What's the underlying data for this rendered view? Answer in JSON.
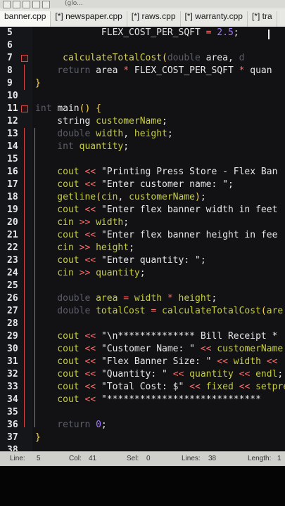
{
  "toolbar": {
    "hint": "(glo..."
  },
  "tabs": [
    {
      "label": "banner.cpp",
      "active": true
    },
    {
      "label": "[*] newspaper.cpp",
      "active": false
    },
    {
      "label": "[*] raws.cpp",
      "active": false
    },
    {
      "label": "[*] warranty.cpp",
      "active": false
    },
    {
      "label": "[*] tra",
      "active": false
    }
  ],
  "editor": {
    "lines": [
      {
        "n": "5",
        "parts": [
          [
            "t",
            "            FLEX_COST_PER_SQFT "
          ],
          [
            "op",
            "="
          ],
          [
            "num",
            " 2.5"
          ],
          [
            "t",
            ";"
          ]
        ]
      },
      {
        "n": "6",
        "parts": []
      },
      {
        "n": "7",
        "fold": true,
        "parts": [
          [
            "dim",
            "     "
          ],
          [
            "fn",
            "calculateTotalCost"
          ],
          [
            "br",
            "("
          ],
          [
            "dim",
            "double "
          ],
          [
            "t",
            "area"
          ],
          [
            "t",
            ", "
          ],
          [
            "dim",
            "d "
          ]
        ]
      },
      {
        "n": "8",
        "parts": [
          [
            "dim",
            "    return "
          ],
          [
            "t",
            "area "
          ],
          [
            "op",
            "*"
          ],
          [
            "t",
            " FLEX_COST_PER_SQFT "
          ],
          [
            "op",
            "*"
          ],
          [
            "t",
            " quan"
          ]
        ]
      },
      {
        "n": "9",
        "parts": [
          [
            "br",
            "}"
          ]
        ]
      },
      {
        "n": "10",
        "parts": []
      },
      {
        "n": "11",
        "fold": true,
        "parts": [
          [
            "dim",
            "int "
          ],
          [
            "t",
            "main"
          ],
          [
            "br",
            "()"
          ],
          [
            "t",
            " "
          ],
          [
            "br",
            "{"
          ]
        ]
      },
      {
        "n": "12",
        "parts": [
          [
            "t",
            "    string "
          ],
          [
            "k",
            "customerName"
          ],
          [
            "t",
            ";"
          ]
        ]
      },
      {
        "n": "13",
        "parts": [
          [
            "dim",
            "    double "
          ],
          [
            "k",
            "width"
          ],
          [
            "t",
            ", "
          ],
          [
            "k",
            "height"
          ],
          [
            "t",
            ";"
          ]
        ]
      },
      {
        "n": "14",
        "parts": [
          [
            "dim",
            "    int "
          ],
          [
            "k",
            "quantity"
          ],
          [
            "t",
            ";"
          ]
        ]
      },
      {
        "n": "15",
        "parts": []
      },
      {
        "n": "16",
        "parts": [
          [
            "k",
            "    cout "
          ],
          [
            "op",
            "<<"
          ],
          [
            "t",
            " \"Printing Press Store - Flex Ban"
          ]
        ]
      },
      {
        "n": "17",
        "parts": [
          [
            "k",
            "    cout "
          ],
          [
            "op",
            "<<"
          ],
          [
            "t",
            " \"Enter customer name: \""
          ],
          [
            "t",
            ";"
          ]
        ]
      },
      {
        "n": "18",
        "parts": [
          [
            "k",
            "    getline"
          ],
          [
            "br",
            "("
          ],
          [
            "k",
            "cin"
          ],
          [
            "t",
            ", "
          ],
          [
            "k",
            "customerName"
          ],
          [
            "br",
            ")"
          ],
          [
            "t",
            ";"
          ]
        ]
      },
      {
        "n": "19",
        "parts": [
          [
            "k",
            "    cout "
          ],
          [
            "op",
            "<<"
          ],
          [
            "t",
            " \"Enter flex banner width in feet"
          ]
        ]
      },
      {
        "n": "20",
        "parts": [
          [
            "k",
            "    cin "
          ],
          [
            "op",
            ">>"
          ],
          [
            "k",
            " width"
          ],
          [
            "t",
            ";"
          ]
        ]
      },
      {
        "n": "21",
        "parts": [
          [
            "k",
            "    cout "
          ],
          [
            "op",
            "<<"
          ],
          [
            "t",
            " \"Enter flex banner height in fee"
          ]
        ]
      },
      {
        "n": "22",
        "parts": [
          [
            "k",
            "    cin "
          ],
          [
            "op",
            ">>"
          ],
          [
            "k",
            " height"
          ],
          [
            "t",
            ";"
          ]
        ]
      },
      {
        "n": "23",
        "parts": [
          [
            "k",
            "    cout "
          ],
          [
            "op",
            "<<"
          ],
          [
            "t",
            " \"Enter quantity: \""
          ],
          [
            "t",
            ";"
          ]
        ]
      },
      {
        "n": "24",
        "parts": [
          [
            "k",
            "    cin "
          ],
          [
            "op",
            ">>"
          ],
          [
            "k",
            " quantity"
          ],
          [
            "t",
            ";"
          ]
        ]
      },
      {
        "n": "25",
        "parts": []
      },
      {
        "n": "26",
        "parts": [
          [
            "dim",
            "    double "
          ],
          [
            "k",
            "area "
          ],
          [
            "op",
            "="
          ],
          [
            "k",
            " width "
          ],
          [
            "op",
            "*"
          ],
          [
            "k",
            " height"
          ],
          [
            "t",
            ";"
          ]
        ]
      },
      {
        "n": "27",
        "parts": [
          [
            "dim",
            "    double "
          ],
          [
            "k",
            "totalCost "
          ],
          [
            "op",
            "="
          ],
          [
            "k",
            " calculateTotalCost"
          ],
          [
            "br",
            "("
          ],
          [
            "k",
            "are"
          ]
        ]
      },
      {
        "n": "28",
        "parts": []
      },
      {
        "n": "29",
        "parts": [
          [
            "k",
            "    cout "
          ],
          [
            "op",
            "<<"
          ],
          [
            "t",
            " \"\\n************** Bill Receipt *"
          ]
        ]
      },
      {
        "n": "30",
        "parts": [
          [
            "k",
            "    cout "
          ],
          [
            "op",
            "<<"
          ],
          [
            "t",
            " \"Customer Name: \" "
          ],
          [
            "op",
            "<<"
          ],
          [
            "k",
            " customerName"
          ]
        ]
      },
      {
        "n": "31",
        "parts": [
          [
            "k",
            "    cout "
          ],
          [
            "op",
            "<<"
          ],
          [
            "t",
            " \"Flex Banner Size: \" "
          ],
          [
            "op",
            "<<"
          ],
          [
            "k",
            " width "
          ],
          [
            "op",
            "<<"
          ]
        ]
      },
      {
        "n": "32",
        "parts": [
          [
            "k",
            "    cout "
          ],
          [
            "op",
            "<<"
          ],
          [
            "t",
            " \"Quantity: \" "
          ],
          [
            "op",
            "<<"
          ],
          [
            "k",
            " quantity "
          ],
          [
            "op",
            "<<"
          ],
          [
            "k",
            " endl"
          ],
          [
            "t",
            ";"
          ]
        ]
      },
      {
        "n": "33",
        "parts": [
          [
            "k",
            "    cout "
          ],
          [
            "op",
            "<<"
          ],
          [
            "t",
            " \"Total Cost: $\" "
          ],
          [
            "op",
            "<<"
          ],
          [
            "k",
            " fixed "
          ],
          [
            "op",
            "<<"
          ],
          [
            "k",
            " setpre"
          ]
        ]
      },
      {
        "n": "34",
        "parts": [
          [
            "k",
            "    cout "
          ],
          [
            "op",
            "<<"
          ],
          [
            "t",
            " \"****************************"
          ]
        ]
      },
      {
        "n": "35",
        "parts": []
      },
      {
        "n": "36",
        "parts": [
          [
            "dim",
            "    return "
          ],
          [
            "num",
            "0"
          ],
          [
            "t",
            ";"
          ]
        ]
      },
      {
        "n": "37",
        "parts": [
          [
            "br",
            "}"
          ]
        ]
      },
      {
        "n": "38",
        "parts": []
      }
    ]
  },
  "status": {
    "line_label": "Line:",
    "line_value": "5",
    "col_label": "Col:",
    "col_value": "41",
    "sel_label": "Sel:",
    "sel_value": "0",
    "lines_label": "Lines:",
    "lines_value": "38",
    "length_label": "Length:",
    "length_value": "1"
  }
}
